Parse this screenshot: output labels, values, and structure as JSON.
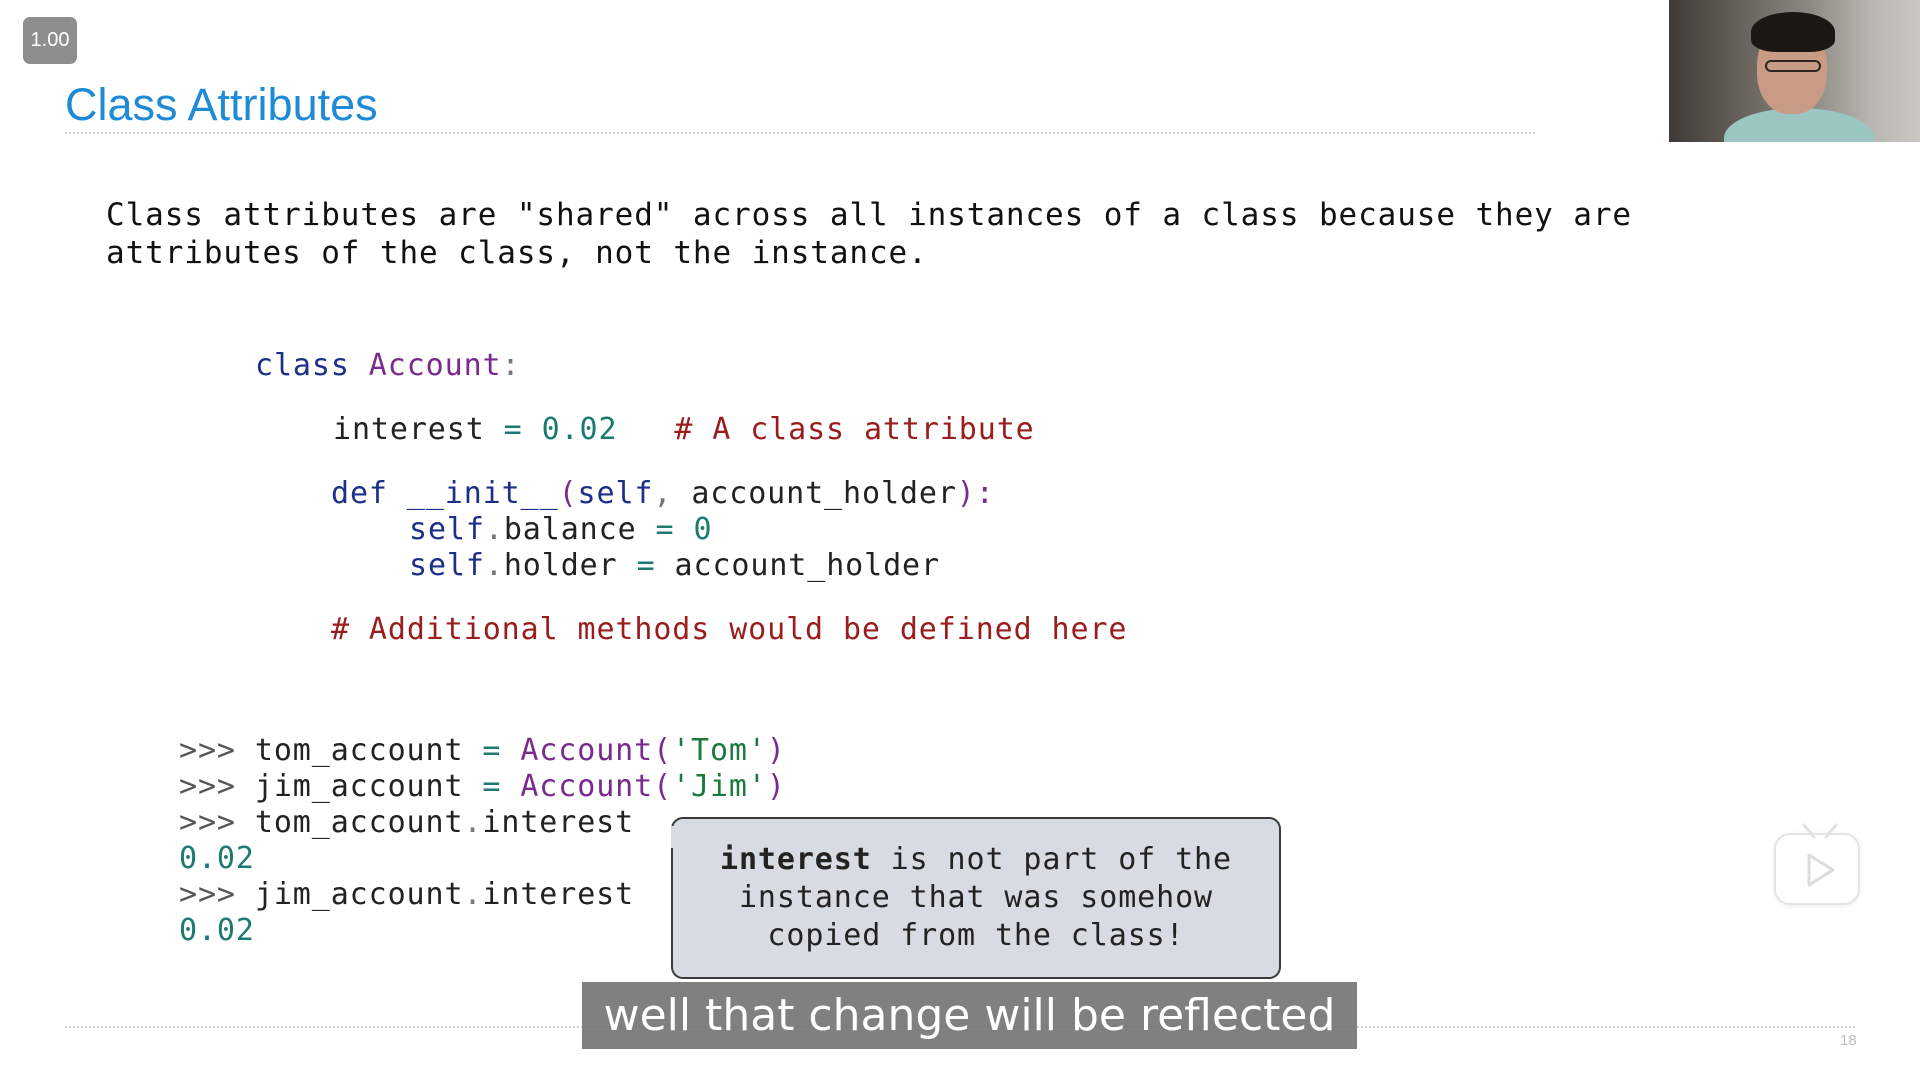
{
  "player": {
    "speed": "1.00",
    "subtitle": "well that change will be reflected",
    "page_number": "18"
  },
  "slide": {
    "title": "Class Attributes",
    "intro_line1": "Class attributes are \"shared\" across all instances of a class because they are",
    "intro_line2": "attributes of the class, not the instance.",
    "code": {
      "kw_class": "class",
      "class_name": "Account",
      "colon": ":",
      "interest_name": "interest",
      "eq": "=",
      "interest_value": "0.02",
      "interest_comment": "# A class attribute",
      "kw_def": "def",
      "init_name": "__init__",
      "paren_open": "(",
      "self_param": "self",
      "comma": ",",
      "holder_param": "account_holder",
      "paren_close_colon": "):",
      "self1": "self",
      "dot1": ".",
      "balance_attr": "balance",
      "eq2": "=",
      "zero": "0",
      "self2": "self",
      "dot2": ".",
      "holder_attr": "holder",
      "eq3": "=",
      "holder_value": "account_holder",
      "methods_comment": "# Additional methods would be defined here"
    },
    "repl": {
      "prompt": ">>>",
      "line1_var": "tom_account",
      "line1_eq": "=",
      "line1_class": "Account",
      "line1_open": "(",
      "line1_arg": "'Tom'",
      "line1_close": ")",
      "line2_var": "jim_account",
      "line2_eq": "=",
      "line2_class": "Account",
      "line2_open": "(",
      "line2_arg": "'Jim'",
      "line2_close": ")",
      "line3_obj": "tom_account",
      "line3_dot": ".",
      "line3_attr": "interest",
      "output1": "0.02",
      "line4_obj": "jim_account",
      "line4_dot": ".",
      "line4_attr": "interest",
      "output2": "0.02"
    },
    "callout": {
      "bold": "interest",
      "line1_rest": " is not part of the",
      "line2": "instance that was somehow",
      "line3": "copied from the class!"
    }
  },
  "icons": {
    "play": "play-icon",
    "presenter": "presenter-webcam"
  }
}
